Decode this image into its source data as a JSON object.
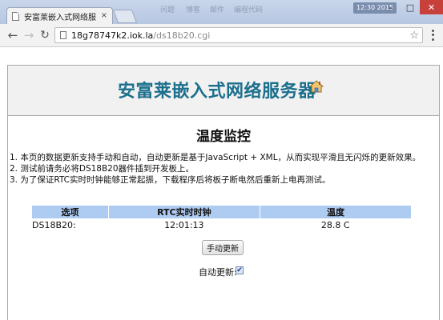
{
  "browser": {
    "tab_title": "安富莱嵌入式网络服务器",
    "tab_close": "×",
    "faded_titles": [
      "问题",
      "博客",
      "邮件",
      "编程代码"
    ],
    "system_tag": "12:30 2015",
    "window_buttons": {
      "minimize": "–",
      "maximize": "□",
      "close": "✕"
    }
  },
  "toolbar": {
    "back_icon": "←",
    "forward_icon": "→",
    "reload_icon": "↻",
    "url_host": "18g78747k2.iok.la",
    "url_path": "/ds18b20.cgi",
    "star_icon": "☆"
  },
  "page": {
    "site_title": "安富莱嵌入式网络服务器",
    "section_title": "温度监控",
    "notes": [
      "1. 本页的数据更新支持手动和自动，自动更新是基于JavaScript + XML，从而实现平滑且无闪烁的更新效果。",
      "2. 测试前请务必将DS18B20器件插到开发板上。",
      "3. 为了保证RTC实时时钟能够正常起振，下载程序后将板子断电然后重新上电再测试。"
    ],
    "table": {
      "headers": [
        "选项",
        "RTC实时时钟",
        "温度"
      ],
      "row": [
        "DS18B20:",
        "12:01:13",
        "28.8 C"
      ]
    },
    "refresh_button": "手动更新",
    "auto_update_label": "自动更新:",
    "auto_update_checked": true,
    "auto_update_check_glyph": "✔"
  },
  "colors": {
    "title_color": "#1b6f8c",
    "table_header_bg": "#aecbf2",
    "header_bg": "#f1f1f1"
  }
}
